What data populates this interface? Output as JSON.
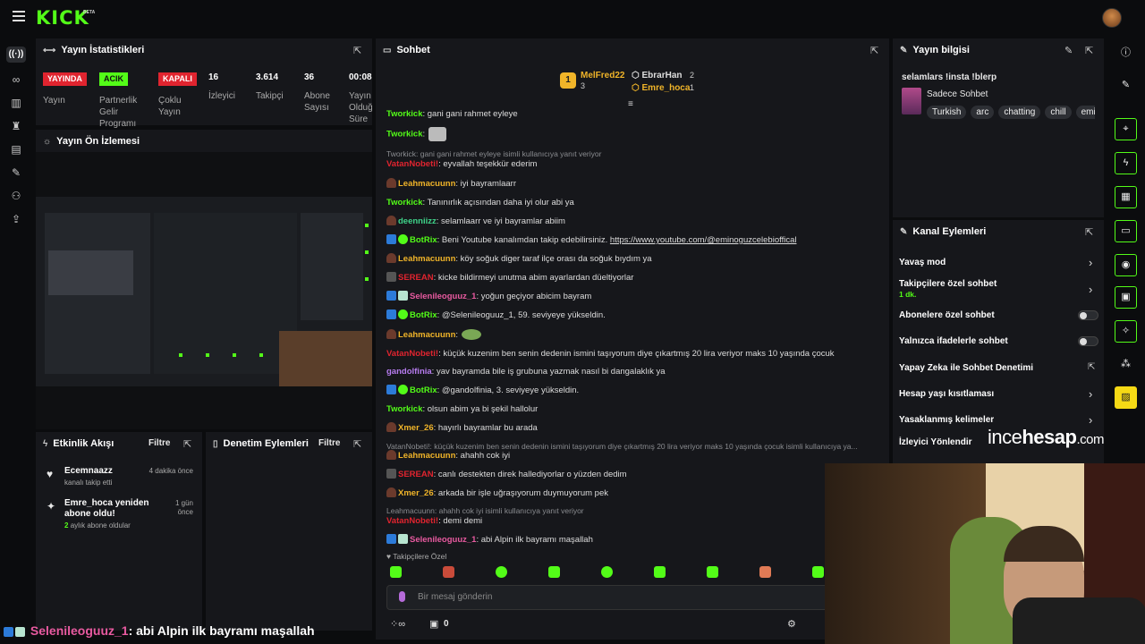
{
  "brand": {
    "logo": "KICK",
    "beta": "BETA"
  },
  "stats": {
    "title": "Yayın İstatistikleri",
    "badges": [
      {
        "label": "YAYINDA",
        "color": "#e0242f"
      },
      {
        "label": "ACIK",
        "color": "#53fc18"
      },
      {
        "label": "KAPALI",
        "color": "#e0242f"
      }
    ],
    "labels": [
      "Yayın",
      "Partnerlik Gelir Programı",
      "Çoklu Yayın"
    ],
    "numbers": [
      {
        "value": "16",
        "label": "İzleyici"
      },
      {
        "value": "3.614",
        "label": "Takipçi"
      },
      {
        "value": "36",
        "label": "Abone Sayısı"
      },
      {
        "value": "00:08",
        "label": "Yayın Olduğu Süre"
      }
    ]
  },
  "preview": {
    "title": "Yayın Ön İzlemesi"
  },
  "chat": {
    "title": "Sohbet",
    "top": [
      {
        "name": "MelFred22",
        "count": "3"
      },
      {
        "name": "EbrarHan",
        "count": "2"
      },
      {
        "name": "Emre_hoca",
        "count": "1"
      }
    ],
    "messages": [
      {
        "user": "Tworkick",
        "color": "#53fc18",
        "text": ": gani gani rahmet eyleye"
      },
      {
        "user": "Tworkick",
        "color": "#53fc18",
        "text": ":",
        "emote": true
      },
      {
        "reply": "Tworkick: gani gani rahmet eyleye isimli kullanıcıya yanıt veriyor"
      },
      {
        "user": "VatanNobeti!",
        "color": "#e0242f",
        "text": ": eyvallah teşekkür ederim"
      },
      {
        "user": "Leahmacuunn",
        "color": "#f0b429",
        "text": ": iyi bayramlaarr",
        "hat": true
      },
      {
        "user": "Tworkick",
        "color": "#53fc18",
        "text": ": Tanınırlık açısından daha iyi olur abi ya"
      },
      {
        "user": "deenniizz",
        "color": "#3fd48a",
        "text": ": selamlaarr ve iyi bayramlar abiim",
        "hat": true
      },
      {
        "user": "BotRix",
        "color": "#53fc18",
        "text": ": Beni Youtube kanalımdan takip edebilirsiniz. ",
        "link": "https://www.youtube.com/@eminoguzcelebioffical",
        "bot": true
      },
      {
        "user": "Leahmacuunn",
        "color": "#f0b429",
        "text": ": köy soğuk diger taraf ilçe orası da soğuk bıydım ya",
        "hat": true
      },
      {
        "user": "SEREAN",
        "color": "#e0242f",
        "text": ": kicke bildirmeyi unutma abim ayarlardan düeltiyorlar",
        "pen": true
      },
      {
        "user": "Selenileoguuz_1",
        "color": "#e85aa0",
        "text": ": yoğun geçiyor abicim bayram",
        "sub": true
      },
      {
        "user": "BotRix",
        "color": "#53fc18",
        "text": ": @Selenileoguuz_1, 59. seviyeye yükseldin.",
        "bot": true
      },
      {
        "user": "Leahmacuunn",
        "color": "#f0b429",
        "text": ":",
        "hat": true,
        "emote2": true
      },
      {
        "user": "VatanNobeti!",
        "color": "#e0242f",
        "text": ": küçük kuzenim ben senin dedenin ismini taşıyorum diye çıkartmış 20 lira veriyor maks 10 yaşında çocuk"
      },
      {
        "user": "gandolfinia",
        "color": "#b77cf0",
        "text": ": yav bayramda bile iş grubuna yazmak nasıl bi dangalaklık ya"
      },
      {
        "user": "BotRix",
        "color": "#53fc18",
        "text": ": @gandolfinia, 3. seviyeye yükseldin.",
        "bot": true
      },
      {
        "user": "Tworkick",
        "color": "#53fc18",
        "text": ": olsun abim ya bi şekil hallolur"
      },
      {
        "user": "Xmer_26",
        "color": "#f0b429",
        "text": ": hayırlı bayramlar bu arada",
        "hat": true
      },
      {
        "reply": "VatanNobeti!: küçük kuzenim ben senin dedenin ismini taşıyorum diye çıkartmış 20 lira veriyor maks 10 yaşında çocuk isimli kullanıcıya ya..."
      },
      {
        "user": "Leahmacuunn",
        "color": "#f0b429",
        "text": ": ahahh cok iyi",
        "hat": true
      },
      {
        "user": "SEREAN",
        "color": "#e0242f",
        "text": ": canlı destekten direk hallediyorlar o yüzden dedim",
        "pen": true
      },
      {
        "user": "Xmer_26",
        "color": "#f0b429",
        "text": ": arkada bir işle uğraşıyorum duymuyorum pek",
        "hat": true
      },
      {
        "reply": "Leahmacuunn: ahahh cok iyi isimli kullanıcıya yanıt veriyor"
      },
      {
        "user": "VatanNobeti!",
        "color": "#e0242f",
        "text": ": demi demi"
      },
      {
        "user": "Selenileoguuz_1",
        "color": "#e85aa0",
        "text": ": abi Alpin ilk bayramı maşallah",
        "sub": true
      }
    ],
    "followers_only": "Takipçilere Özel",
    "input_placeholder": "Bir mesaj gönderin",
    "points": "0"
  },
  "info": {
    "title": "Yayın bilgisi",
    "stream_title": "selamlars !insta !blerp",
    "category": "Sadece Sohbet",
    "tags": [
      "Turkish",
      "arc",
      "chatting",
      "chill",
      "emir"
    ]
  },
  "actions": {
    "title": "Kanal Eylemleri",
    "items": [
      {
        "label": "Yavaş mod",
        "kind": "chevron"
      },
      {
        "label": "Takipçilere özel sohbet",
        "sub": "1 dk.",
        "kind": "chevron"
      },
      {
        "label": "Abonelere özel sohbet",
        "kind": "toggle"
      },
      {
        "label": "Yalnızca ifadelerle sohbet",
        "kind": "toggle"
      },
      {
        "label": "Yapay Zeka ile Sohbet Denetimi",
        "kind": "external"
      },
      {
        "label": "Hesap yaşı kısıtlaması",
        "kind": "chevron"
      },
      {
        "label": "Yasaklanmış kelimeler",
        "kind": "chevron"
      },
      {
        "label": "İzleyici Yönlendir",
        "kind": "none"
      }
    ]
  },
  "events": {
    "title": "Etkinlik Akışı",
    "filter": "Filtre",
    "items": [
      {
        "name": "Ecemnaazz",
        "desc": "kanalı takip etti",
        "time": "4 dakika önce"
      },
      {
        "name": "Emre_hoca yeniden abone oldu!",
        "desc_strong": "2",
        "desc": "aylık abone oldular",
        "time": "1 gün önce"
      }
    ]
  },
  "moderation": {
    "title": "Denetim Eylemleri",
    "filter": "Filtre"
  },
  "watermark": {
    "a": "ince",
    "b": "hesap",
    "c": ".com"
  },
  "overlay": {
    "user": "Selenileoguuz_1",
    "text": ": abi Alpin ilk bayramı maşallah"
  }
}
